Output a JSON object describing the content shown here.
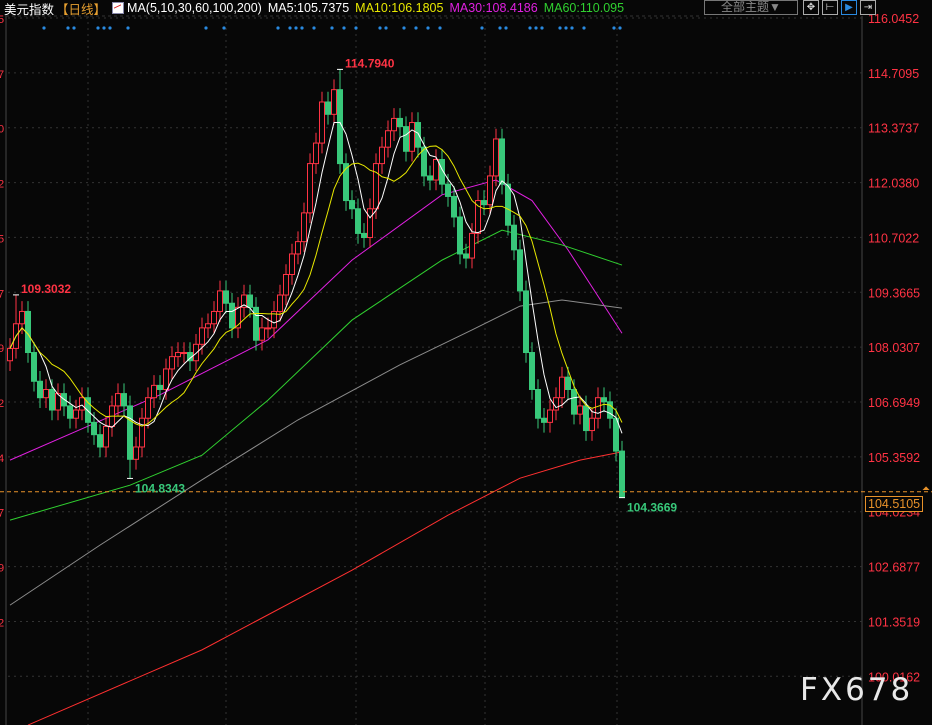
{
  "header": {
    "title": "美元指数",
    "period": "【日线】",
    "ma_params": "MA(5,10,30,60,100,200)",
    "ma5": "MA5:105.7375",
    "ma10": "MA10:106.1805",
    "ma30": "MA30:108.4186",
    "ma60": "MA60:110.095"
  },
  "toolbar": {
    "theme_label": "全部主题▼",
    "icons": [
      "crosshair-icon",
      "range-icon",
      "play-icon",
      "exit-icon"
    ],
    "icon_glyphs": [
      "✥",
      "⊢",
      "▶",
      "⇥"
    ]
  },
  "current_price": "104.5105",
  "watermark": "FX678",
  "colors": {
    "up": "#ff3344",
    "down": "#38c87a",
    "ma5": "#ffffff",
    "ma10": "#e8e800",
    "ma30": "#e020e0",
    "ma60": "#30d030",
    "ma100": "#8c8c8c",
    "ma200": "#ff3030",
    "axis": "#ff3344"
  },
  "chart_data": {
    "type": "candlestick",
    "title": "美元指数 日线",
    "ylim": [
      99.2,
      116.5
    ],
    "yticks": [
      "116.0452",
      "114.7095",
      "113.3737",
      "112.0380",
      "110.7022",
      "109.3665",
      "108.0307",
      "106.6949",
      "105.3592",
      "104.0234",
      "102.6877",
      "101.3519",
      "100.0162"
    ],
    "left_tick_fragments": [
      "5",
      "7",
      "0",
      "2",
      "5",
      "7",
      "9",
      "2",
      "4",
      "7",
      "9",
      "2"
    ],
    "annotations": [
      {
        "text": "114.7940",
        "index": 55,
        "value": 114.794,
        "kind": "high"
      },
      {
        "text": "109.3032",
        "index": 1,
        "value": 109.3032,
        "kind": "high"
      },
      {
        "text": "104.8343",
        "index": 20,
        "value": 104.8343,
        "kind": "low"
      },
      {
        "text": "104.3669",
        "index": 102,
        "value": 104.3669,
        "kind": "low"
      }
    ],
    "close": [
      108.0,
      108.6,
      108.9,
      107.9,
      107.2,
      106.8,
      107.0,
      106.5,
      106.9,
      106.6,
      106.3,
      106.5,
      106.8,
      106.2,
      105.9,
      105.6,
      106.1,
      106.6,
      106.9,
      106.6,
      105.3,
      105.6,
      106.3,
      106.8,
      107.1,
      107.0,
      107.5,
      107.8,
      107.9,
      107.9,
      107.7,
      108.1,
      108.5,
      108.6,
      108.9,
      109.4,
      109.1,
      108.5,
      109.0,
      109.3,
      109.0,
      108.2,
      108.5,
      108.5,
      108.9,
      109.3,
      109.8,
      110.3,
      110.6,
      111.3,
      112.5,
      113.0,
      114.0,
      113.7,
      114.3,
      112.5,
      111.6,
      111.4,
      110.8,
      110.7,
      111.4,
      112.5,
      112.9,
      113.3,
      113.6,
      113.4,
      112.8,
      113.5,
      112.9,
      112.2,
      112.1,
      112.6,
      112.0,
      111.7,
      111.2,
      110.3,
      110.2,
      110.8,
      111.6,
      111.5,
      112.2,
      113.1,
      112.0,
      111.0,
      110.4,
      109.4,
      107.9,
      107.0,
      106.3,
      106.2,
      106.5,
      106.8,
      107.3,
      107.0,
      106.4,
      106.6,
      106.0,
      106.3,
      106.8,
      106.7,
      106.3,
      105.5,
      104.37
    ],
    "moving_averages": {
      "MA30": [
        [
          0,
          105.28
        ],
        [
          25,
          106.87
        ],
        [
          43,
          108.21
        ],
        [
          57,
          110.15
        ],
        [
          72,
          111.74
        ],
        [
          81,
          112.1
        ],
        [
          87,
          111.6
        ],
        [
          93,
          110.4
        ],
        [
          102,
          108.37
        ]
      ],
      "MA60": [
        [
          0,
          103.82
        ],
        [
          20,
          104.67
        ],
        [
          32,
          105.4
        ],
        [
          43,
          106.74
        ],
        [
          57,
          108.69
        ],
        [
          72,
          110.15
        ],
        [
          82,
          110.88
        ],
        [
          92,
          110.52
        ],
        [
          102,
          110.03
        ]
      ],
      "MA100": [
        [
          0,
          101.75
        ],
        [
          15,
          103.21
        ],
        [
          32,
          104.8
        ],
        [
          48,
          106.26
        ],
        [
          65,
          107.6
        ],
        [
          77,
          108.45
        ],
        [
          85,
          109.03
        ],
        [
          92,
          109.18
        ],
        [
          102,
          108.98
        ]
      ],
      "MA200": [
        [
          3,
          98.83
        ],
        [
          32,
          100.66
        ],
        [
          57,
          102.6
        ],
        [
          73,
          103.94
        ],
        [
          85,
          104.84
        ],
        [
          95,
          105.28
        ],
        [
          102,
          105.48
        ]
      ]
    },
    "event_markers": [
      6,
      10,
      11,
      15,
      16,
      17,
      20,
      33,
      36,
      45,
      47,
      48,
      49,
      51,
      54,
      56,
      58,
      62,
      63,
      66,
      68,
      70,
      72,
      79,
      82,
      83,
      87,
      88,
      89,
      92,
      93,
      94,
      96,
      101,
      102
    ]
  }
}
